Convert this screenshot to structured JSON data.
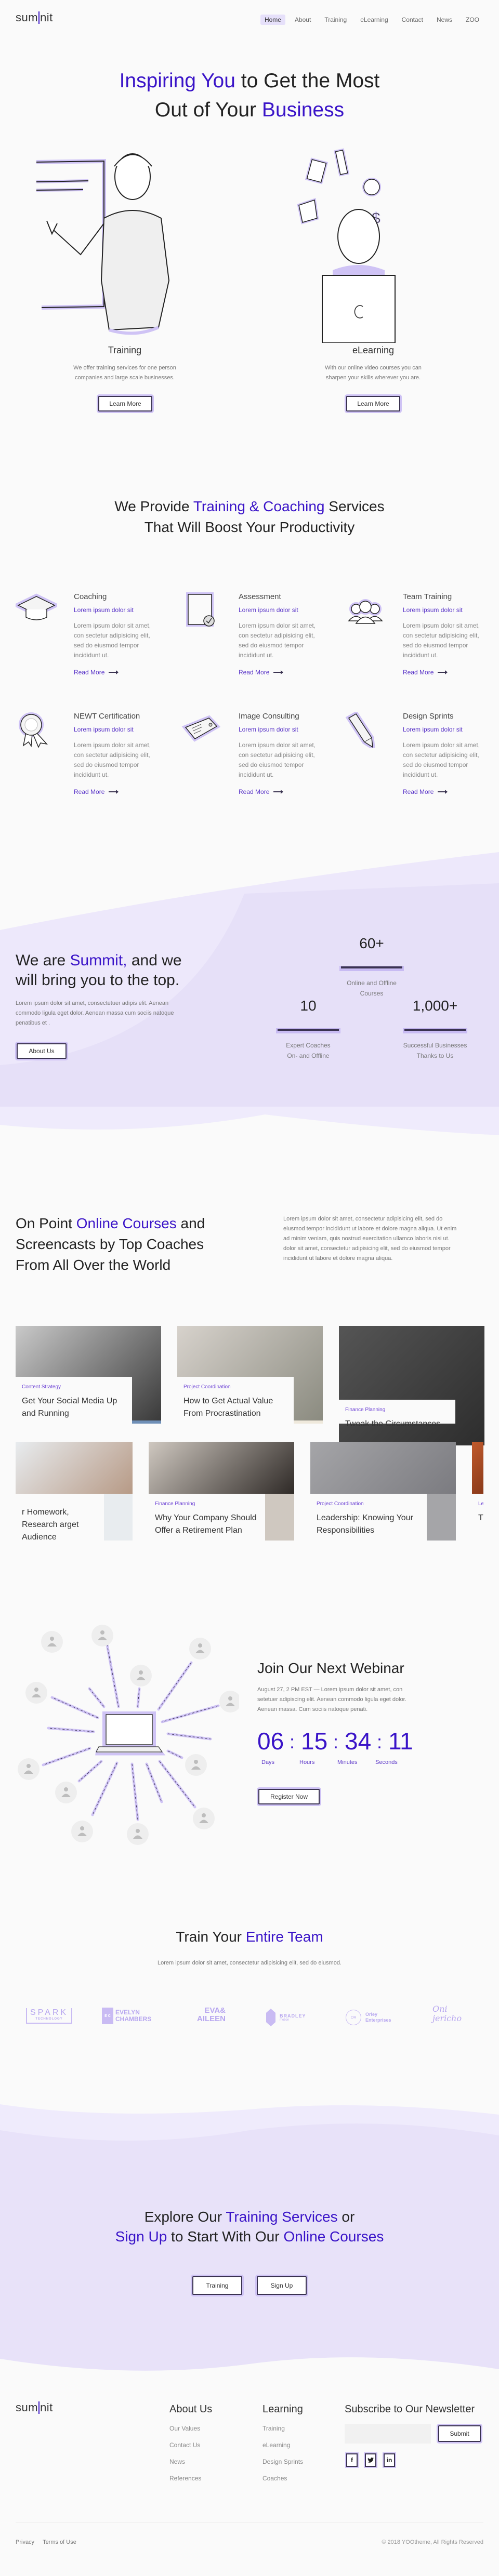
{
  "brand": {
    "logo_left": "sum",
    "logo_right": "nit",
    "accent": "#3a14c8",
    "lavender": "#e8e2f9"
  },
  "nav": {
    "items": [
      {
        "label": "Home",
        "active": true
      },
      {
        "label": "About"
      },
      {
        "label": "Training"
      },
      {
        "label": "eLearning"
      },
      {
        "label": "Contact"
      },
      {
        "label": "News"
      },
      {
        "label": "ZOO"
      }
    ]
  },
  "hero": {
    "title_a1": "Inspiring You",
    "title_b1": " to Get the Most",
    "title_b2": "Out of Your ",
    "title_a2": "Business",
    "columns": [
      {
        "title": "Training",
        "text_1": "We offer training services for one person",
        "text_2": "companies and large scale businesses.",
        "button": "Learn More",
        "illustration": "presenter-illustration"
      },
      {
        "title": "eLearning",
        "text_1": "With our online video courses you can",
        "text_2": "sharpen your skills wherever you are.",
        "button": "Learn More",
        "illustration": "laptop-learner-illustration"
      }
    ]
  },
  "services": {
    "title_b1": "We Provide ",
    "title_a1": "Training & Coaching",
    "title_b2": " Services",
    "title_line2": "That Will Boost Your Productivity",
    "items": [
      {
        "title": "Coaching",
        "subtitle": "Lorem ipsum dolor sit",
        "text": "Lorem ipsum dolor sit amet, con sectetur adipisicing elit, sed do eiusmod tempor incididunt ut.",
        "link": "Read More",
        "icon": "graduation-cap-icon"
      },
      {
        "title": "Assessment",
        "subtitle": "Lorem ipsum dolor sit",
        "text": "Lorem ipsum dolor sit amet, con sectetur adipisicing elit, sed do eiusmod tempor incididunt ut.",
        "link": "Read More",
        "icon": "clipboard-check-icon"
      },
      {
        "title": "Team Training",
        "subtitle": "Lorem ipsum dolor sit",
        "text": "Lorem ipsum dolor sit amet, con sectetur adipisicing elit, sed do eiusmod tempor incididunt ut.",
        "link": "Read More",
        "icon": "team-icon"
      },
      {
        "title": "NEWT Certification",
        "subtitle": "Lorem ipsum dolor sit",
        "text": "Lorem ipsum dolor sit amet, con sectetur adipisicing elit, sed do eiusmod tempor incididunt ut.",
        "link": "Read More",
        "icon": "award-ribbon-icon"
      },
      {
        "title": "Image Consulting",
        "subtitle": "Lorem ipsum dolor sit",
        "text": "Lorem ipsum dolor sit amet, con sectetur adipisicing elit, sed do eiusmod tempor incididunt ut.",
        "link": "Read More",
        "icon": "tag-icon"
      },
      {
        "title": "Design Sprints",
        "subtitle": "Lorem ipsum dolor sit",
        "text": "Lorem ipsum dolor sit amet, con sectetur adipisicing elit, sed do eiusmod tempor incididunt ut.",
        "link": "Read More",
        "icon": "pencil-icon"
      }
    ]
  },
  "about": {
    "title_b1": "We are ",
    "title_a1": "Summit,",
    "title_b2": " and we",
    "title_line2": "will bring you to the top.",
    "text": "Lorem ipsum dolor sit amet, consectetuer adipis elit. Aenean commodo ligula eget dolor. Aenean massa cum sociis natoque penatibus et .",
    "button": "About Us",
    "stats": [
      {
        "value": "60+",
        "label_1": "Online and Offline",
        "label_2": "Courses"
      },
      {
        "value": "10",
        "label_1": "Expert Coaches",
        "label_2": "On- and Offline"
      },
      {
        "value": "1,000+",
        "label_1": "Successful Businesses",
        "label_2": "Thanks to Us"
      }
    ]
  },
  "courses": {
    "title_b1": "On Point ",
    "title_a1": "Online Courses",
    "title_b2": " and",
    "title_line2": "Screencasts by Top Coaches",
    "title_line3": "From All Over the World",
    "text": "Lorem ipsum dolor sit amet, consectetur adipisicing elit, sed do eiusmod tempor incididunt ut labore et dolore magna aliqua. Ut enim ad minim veniam, quis nostrud exercitation ullamco laboris nisi ut. dolor sit amet, consectetur adipisicing elit, sed do eiusmod tempor incididunt ut labore et dolore magna aliqua.",
    "row1": [
      {
        "category": "Content Strategy",
        "title": "Get Your Social Media Up and Running"
      },
      {
        "category": "Project Coordination",
        "title": "How to Get Actual Value From Procrastination"
      },
      {
        "category": "Finance Planning",
        "title": "Tweak the Circumstances"
      }
    ],
    "row2": [
      {
        "category": "",
        "title": "r Homework, Research arget Audience"
      },
      {
        "category": "Finance Planning",
        "title": "Why Your Company Should Offer a Retirement Plan"
      },
      {
        "category": "Project Coordination",
        "title": "Leadership: Knowing Your Responsibilities"
      },
      {
        "category": "Le",
        "title": "Th Te"
      }
    ]
  },
  "webinar": {
    "title": "Join Our Next Webinar",
    "text": "August 27, 2 PM EST — Lorem ipsum dolor sit amet, con setetuer adipiscing elit. Aenean commodo ligula eget dolor. Aenean massa. Cum sociis natoque penati.",
    "countdown": [
      {
        "value": "06",
        "label": "Days"
      },
      {
        "value": "15",
        "label": "Hours"
      },
      {
        "value": "34",
        "label": "Minutes"
      },
      {
        "value": "11",
        "label": "Seconds"
      }
    ],
    "separator": ":",
    "button": "Register Now"
  },
  "team": {
    "title_b1": "Train Your ",
    "title_a1": "Entire Team",
    "text": "Lorem ipsum dolor sit amet, consectetur adipisicing elit, sed do eiusmod.",
    "logos": [
      {
        "name": "SPARK",
        "sub": "TECHNOLOGY"
      },
      {
        "name": "EVELYN CHAMBERS",
        "mark": "E C"
      },
      {
        "name": "EVA& AILEEN"
      },
      {
        "name": "BRADLEY",
        "sub": "motion"
      },
      {
        "name": "Orley Enterprises",
        "mark": "OR"
      },
      {
        "name": "Oni jericho"
      }
    ]
  },
  "cta": {
    "line1_b1": "Explore Our ",
    "line1_a1": "Training Services",
    "line1_b2": " or",
    "line2_a1": "Sign Up",
    "line2_b1": " to Start With Our ",
    "line2_a2": "Online Courses",
    "buttons": [
      "Training",
      "Sign Up"
    ]
  },
  "footer": {
    "col1": {
      "title": "About Us",
      "links": [
        "Our Values",
        "Contact Us",
        "News",
        "References"
      ]
    },
    "col2": {
      "title": "Learning",
      "links": [
        "Training",
        "eLearning",
        "Design Sprints",
        "Coaches"
      ]
    },
    "newsletter": {
      "title": "Subscribe to Our Newsletter",
      "email_value": "",
      "submit": "Submit",
      "social": [
        "f",
        "t",
        "in"
      ]
    },
    "bottom_links": [
      "Privacy",
      "Terms of Use"
    ],
    "copyright": "© 2018 YOOtheme, All Rights Reserved"
  }
}
